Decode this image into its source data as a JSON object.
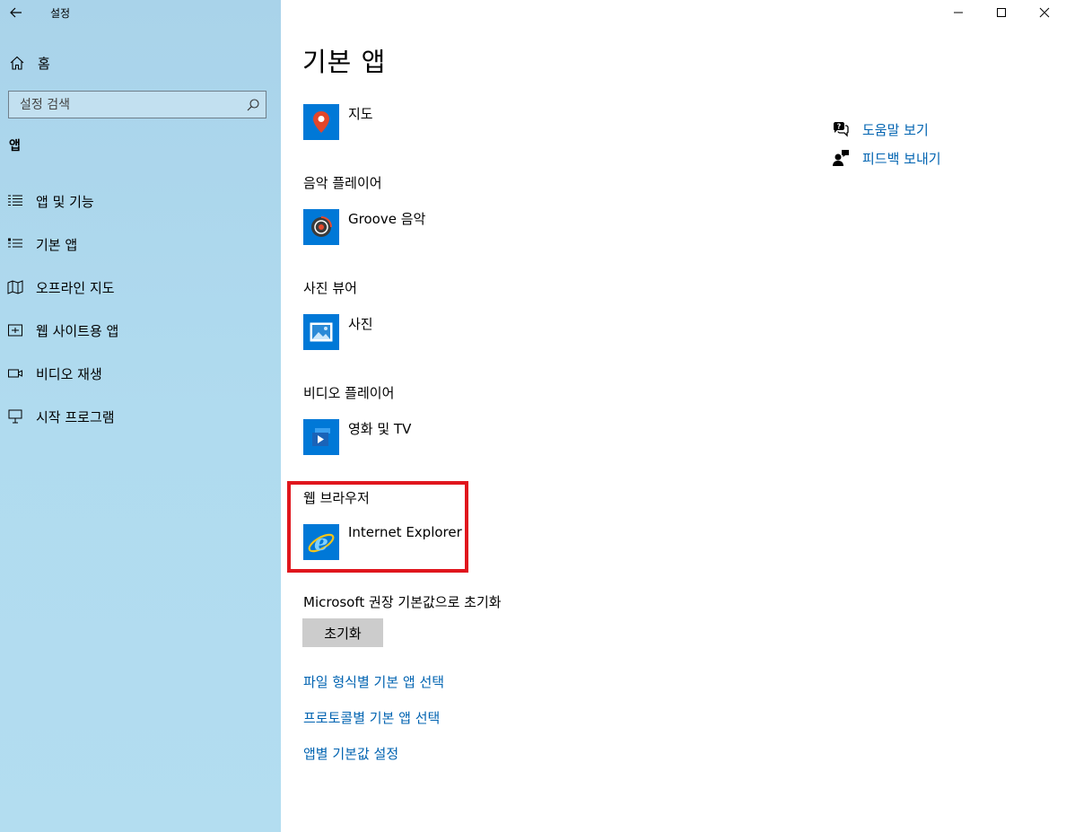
{
  "window": {
    "title": "설정"
  },
  "sidebar": {
    "home_label": "홈",
    "search_placeholder": "설정 검색",
    "section_label": "앱",
    "items": [
      {
        "label": "앱 및 기능",
        "icon": "list-icon"
      },
      {
        "label": "기본 앱",
        "icon": "default-apps-icon"
      },
      {
        "label": "오프라인 지도",
        "icon": "map-icon"
      },
      {
        "label": "웹 사이트용 앱",
        "icon": "website-icon"
      },
      {
        "label": "비디오 재생",
        "icon": "video-icon"
      },
      {
        "label": "시작 프로그램",
        "icon": "startup-icon"
      }
    ]
  },
  "main": {
    "title": "기본 앱",
    "groups": [
      {
        "label": "",
        "app": "지도",
        "icon": "maps-app-icon"
      },
      {
        "label": "음악 플레이어",
        "app": "Groove 음악",
        "icon": "groove-icon"
      },
      {
        "label": "사진 뷰어",
        "app": "사진",
        "icon": "photos-icon"
      },
      {
        "label": "비디오 플레이어",
        "app": "영화 및 TV",
        "icon": "movies-tv-icon"
      },
      {
        "label": "웹 브라우저",
        "app": "Internet Explorer",
        "icon": "internet-explorer-icon"
      }
    ],
    "reset_label": "Microsoft 권장 기본값으로 초기화",
    "reset_button": "초기화",
    "links": [
      "파일 형식별 기본 앱 선택",
      "프로토콜별 기본 앱 선택",
      "앱별 기본값 설정"
    ],
    "side_links": [
      {
        "label": "도움말 보기",
        "icon": "help-icon"
      },
      {
        "label": "피드백 보내기",
        "icon": "feedback-icon"
      }
    ]
  },
  "colors": {
    "accent": "#0078d7",
    "link": "#0063b1",
    "highlight": "#e0161d",
    "sidebar": "#add8ec"
  }
}
